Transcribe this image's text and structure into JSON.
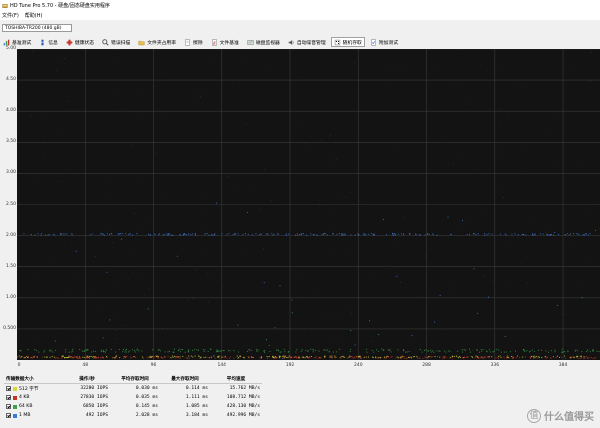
{
  "window": {
    "title": "HD Tune Pro 5.70 - 硬盘/固态硬盘实用程序"
  },
  "menu": {
    "items": [
      "文件(F)",
      "帮助(H)"
    ]
  },
  "drive": {
    "selected": "TOSHIBA-TR200 (480 gB)"
  },
  "tabs": [
    {
      "label": "基准测试",
      "icon": "benchmark-icon"
    },
    {
      "label": "信息",
      "icon": "info-icon"
    },
    {
      "label": "健康状态",
      "icon": "health-icon"
    },
    {
      "label": "错误扫描",
      "icon": "error-scan-icon"
    },
    {
      "label": "文件夹占用率",
      "icon": "folder-usage-icon"
    },
    {
      "label": "擦除",
      "icon": "erase-icon"
    },
    {
      "label": "文件基准",
      "icon": "file-benchmark-icon"
    },
    {
      "label": "磁盘监视器",
      "icon": "disk-monitor-icon"
    },
    {
      "label": "自动噪音管理",
      "icon": "aam-icon"
    },
    {
      "label": "随机存取",
      "icon": "random-access-icon"
    },
    {
      "label": "附加测试",
      "icon": "extra-tests-icon"
    }
  ],
  "active_tab": 9,
  "chart_data": {
    "type": "scatter",
    "y_ticks": [
      "5.00",
      "4.50",
      "4.00",
      "3.50",
      "3.00",
      "2.50",
      "2.00",
      "1.50",
      "1.00",
      "0.500"
    ],
    "x_ticks": [
      "0",
      "48",
      "96",
      "144",
      "192",
      "240",
      "288",
      "336",
      "384"
    ],
    "xlim": [
      0,
      410
    ],
    "ylim": [
      0,
      5.0
    ],
    "ylabel_unit": "ms",
    "grid": true,
    "series": [
      {
        "name": "512 字节",
        "color": "#d8d838",
        "approx_y": 0.05
      },
      {
        "name": "4 KB",
        "color": "#c8342a",
        "approx_y": 0.04
      },
      {
        "name": "64 KB",
        "color": "#3aa04a",
        "approx_y": 0.15
      },
      {
        "name": "1 MB",
        "color": "#3a78d8",
        "approx_y": 2.02
      }
    ]
  },
  "results": {
    "headers": [
      "传输数据大小",
      "操作/秒",
      "平均存取时间",
      "最大存取时间",
      "平均速度"
    ],
    "rows": [
      {
        "size": "512 字节",
        "color": "#d8d838",
        "ops": "32280 IOPS",
        "avg": "0.030 ms",
        "max": "0.114 ms",
        "speed": "15.762 MB/s"
      },
      {
        "size": "4 KB",
        "color": "#c8342a",
        "ops": "27830 IOPS",
        "avg": "0.035 ms",
        "max": "1.111 ms",
        "speed": "108.712 MB/s"
      },
      {
        "size": "64 KB",
        "color": "#3aa04a",
        "ops": "6850 IOPS",
        "avg": "0.145 ms",
        "max": "1.085 ms",
        "speed": "428.130 MB/s"
      },
      {
        "size": "1 MB",
        "color": "#3a78d8",
        "ops": "492 IOPS",
        "avg": "2.028 ms",
        "max": "3.184 ms",
        "speed": "492.996 MB/s"
      }
    ]
  },
  "watermark": {
    "badge": "值",
    "text": "什么值得买"
  }
}
